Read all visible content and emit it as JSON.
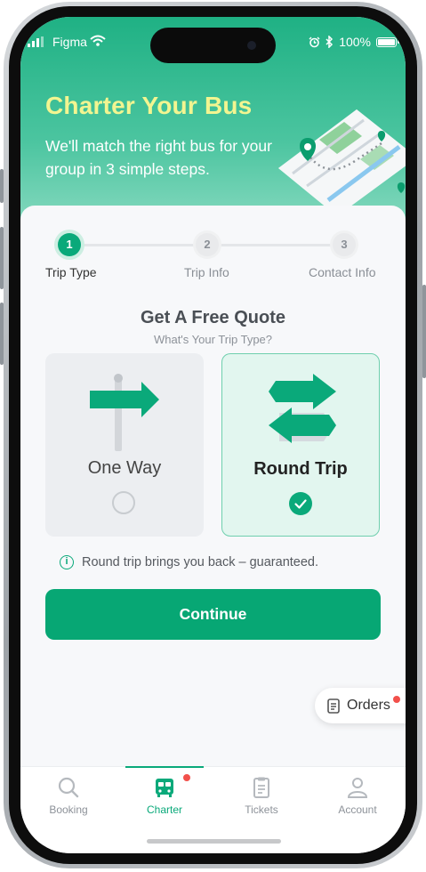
{
  "status_bar": {
    "carrier": "Figma",
    "battery": "100%",
    "battery_level": 1.0
  },
  "hero": {
    "title": "Charter Your Bus",
    "subtitle": "We'll match the right bus for your group in 3 simple steps."
  },
  "stepper": {
    "steps": [
      {
        "number": "1",
        "label": "Trip Type",
        "state": "active"
      },
      {
        "number": "2",
        "label": "Trip Info",
        "state": "upcoming"
      },
      {
        "number": "3",
        "label": "Contact Info",
        "state": "upcoming"
      }
    ]
  },
  "quote": {
    "title": "Get A Free Quote",
    "subtitle": "What's Your Trip Type?"
  },
  "options": [
    {
      "label": "One Way",
      "selected": false,
      "icon": "signpost-icon"
    },
    {
      "label": "Round Trip",
      "selected": true,
      "icon": "round-trip-arrows-icon"
    }
  ],
  "hint": {
    "text": "Round trip brings you back – guaranteed.",
    "icon": "info-icon"
  },
  "continue_label": "Continue",
  "orders_label": "Orders",
  "tabs": [
    {
      "label": "Booking",
      "icon": "search-icon",
      "active": false
    },
    {
      "label": "Charter",
      "icon": "bus-icon",
      "active": true
    },
    {
      "label": "Tickets",
      "icon": "ticket-icon",
      "active": false
    },
    {
      "label": "Account",
      "icon": "person-icon",
      "active": false
    }
  ],
  "colors": {
    "brand": "#07a774",
    "hero_title": "#f2f590",
    "badge": "#f2504b"
  }
}
